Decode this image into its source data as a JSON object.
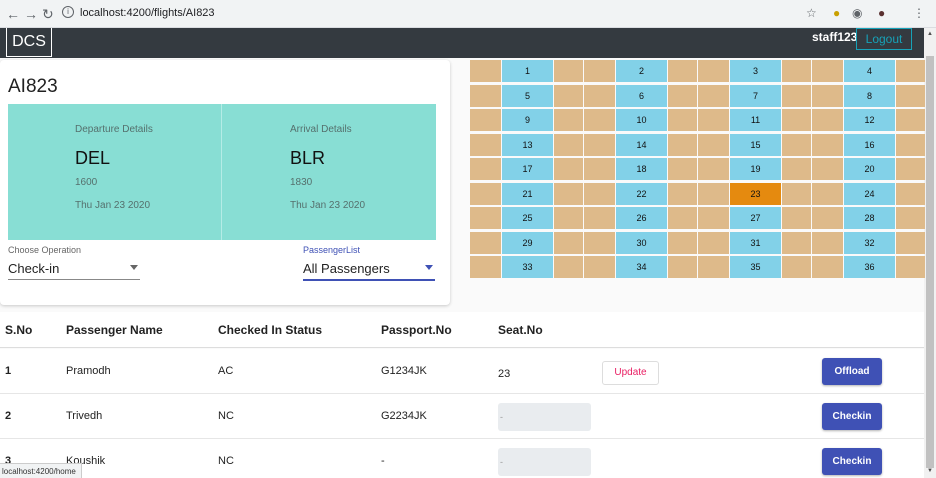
{
  "browser": {
    "back_icon": "back-arrow-icon",
    "forward_icon": "forward-arrow-icon",
    "reload_icon": "reload-icon",
    "url_host": "localhost",
    "url_path": ":4200/flights/AI823",
    "star_icon": "star-icon",
    "menu_icon": "kebab-menu-icon"
  },
  "toolbar": {
    "brand": "DCS",
    "user": "staff123",
    "logout_label": "Logout"
  },
  "flight": {
    "number": "AI823",
    "departure": {
      "label": "Departure Details",
      "code": "DEL",
      "time": "1600",
      "date": "Thu Jan 23 2020"
    },
    "arrival": {
      "label": "Arrival Details",
      "code": "BLR",
      "time": "1830",
      "date": "Thu Jan 23 2020"
    }
  },
  "operation": {
    "label": "Choose Operation",
    "value": "Check-in"
  },
  "passenger_filter": {
    "label": "PassengerList",
    "value": "All Passengers"
  },
  "seats": {
    "rows": [
      [
        "1",
        "2",
        "3",
        "4"
      ],
      [
        "5",
        "6",
        "7",
        "8"
      ],
      [
        "9",
        "10",
        "11",
        "12"
      ],
      [
        "13",
        "14",
        "15",
        "16"
      ],
      [
        "17",
        "18",
        "19",
        "20"
      ],
      [
        "21",
        "22",
        "23",
        "24"
      ],
      [
        "25",
        "26",
        "27",
        "28"
      ],
      [
        "29",
        "30",
        "31",
        "32"
      ],
      [
        "33",
        "34",
        "35",
        "36"
      ]
    ],
    "selected": "23",
    "colors": {
      "seat": "#82d1e8",
      "aisle": "#deba8a",
      "selected": "#e58a0f"
    }
  },
  "table": {
    "headers": {
      "sno": "S.No",
      "name": "Passenger Name",
      "status": "Checked In Status",
      "passport": "Passport.No",
      "seat": "Seat.No"
    },
    "rows": [
      {
        "sno": "1",
        "name": "Pramodh",
        "status": "AC",
        "passport": "G1234JK",
        "seat": "23",
        "seat_placeholder": "",
        "update_label": "Update",
        "action_label": "Offload"
      },
      {
        "sno": "2",
        "name": "Trivedh",
        "status": "NC",
        "passport": "G2234JK",
        "seat": "",
        "seat_placeholder": "-",
        "update_label": "",
        "action_label": "Checkin"
      },
      {
        "sno": "3",
        "name": "Koushik",
        "status": "NC",
        "passport": "-",
        "seat": "",
        "seat_placeholder": "-",
        "update_label": "",
        "action_label": "Checkin"
      }
    ]
  },
  "status_bar": {
    "url": "localhost:4200/home"
  },
  "colors": {
    "toolbar": "#343a40",
    "details_panel": "#88ded4",
    "primary_button": "#3f51b5",
    "update_text": "#e91e63",
    "logout": "#17a2b8"
  }
}
